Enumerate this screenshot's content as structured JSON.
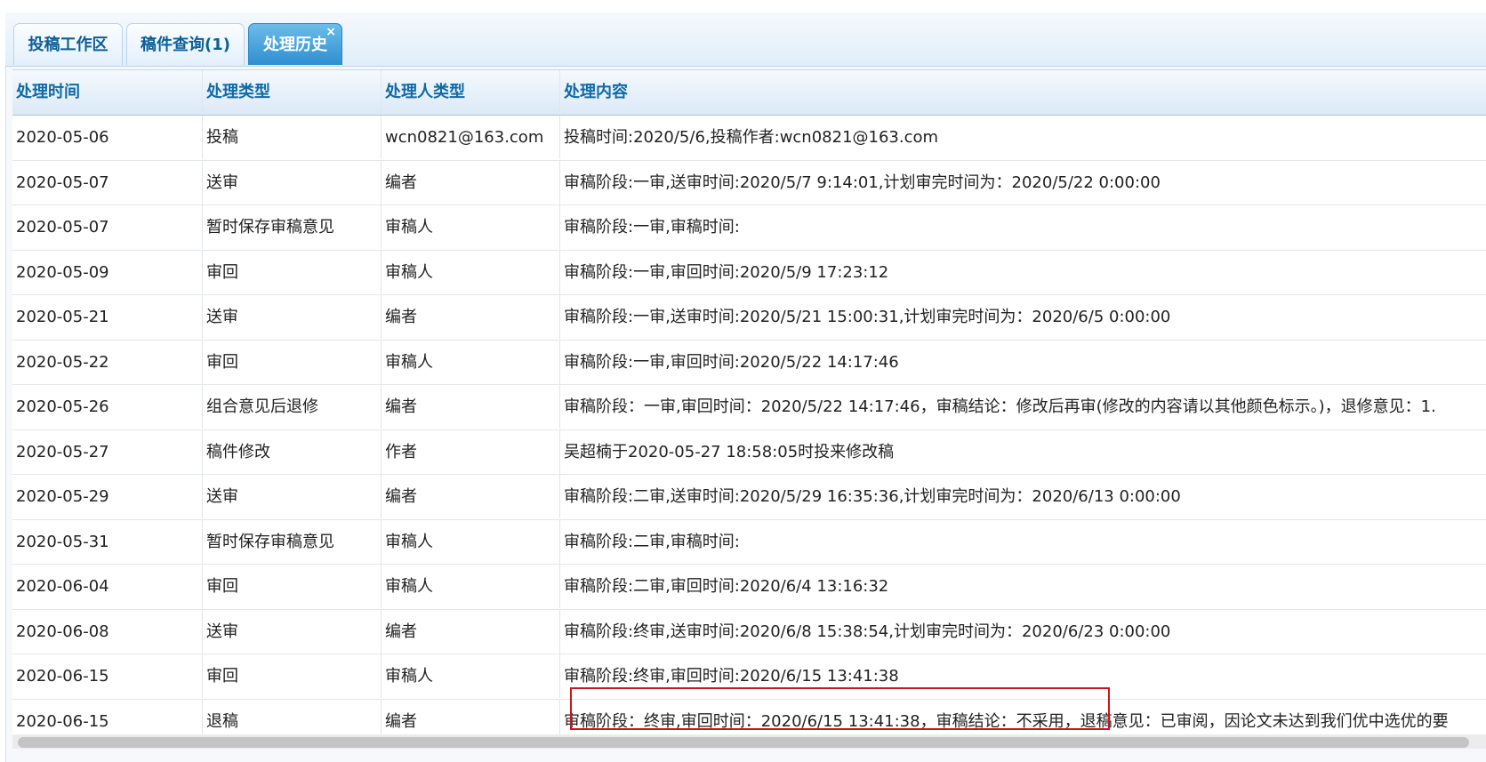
{
  "tabs": [
    {
      "label": "投稿工作区"
    },
    {
      "label": "稿件查询(1)"
    },
    {
      "label": "处理历史",
      "close": "×"
    }
  ],
  "table": {
    "headers": [
      "处理时间",
      "处理类型",
      "处理人类型",
      "处理内容"
    ],
    "rows": [
      [
        "2020-05-06",
        "投稿",
        "wcn0821@163.com",
        "投稿时间:2020/5/6,投稿作者:wcn0821@163.com"
      ],
      [
        "2020-05-07",
        "送审",
        "编者",
        "审稿阶段:一审,送审时间:2020/5/7 9:14:01,计划审完时间为：2020/5/22 0:00:00"
      ],
      [
        "2020-05-07",
        "暂时保存审稿意见",
        "审稿人",
        "审稿阶段:一审,审稿时间:"
      ],
      [
        "2020-05-09",
        "审回",
        "审稿人",
        "审稿阶段:一审,审回时间:2020/5/9 17:23:12"
      ],
      [
        "2020-05-21",
        "送审",
        "编者",
        "审稿阶段:一审,送审时间:2020/5/21 15:00:31,计划审完时间为：2020/6/5 0:00:00"
      ],
      [
        "2020-05-22",
        "审回",
        "审稿人",
        "审稿阶段:一审,审回时间:2020/5/22 14:17:46"
      ],
      [
        "2020-05-26",
        "组合意见后退修",
        "编者",
        "审稿阶段：一审,审回时间：2020/5/22 14:17:46，审稿结论：修改后再审(修改的内容请以其他颜色标示。)，退修意见：1."
      ],
      [
        "2020-05-27",
        "稿件修改",
        "作者",
        "吴超楠于2020-05-27 18:58:05时投来修改稿"
      ],
      [
        "2020-05-29",
        "送审",
        "编者",
        "审稿阶段:二审,送审时间:2020/5/29 16:35:36,计划审完时间为：2020/6/13 0:00:00"
      ],
      [
        "2020-05-31",
        "暂时保存审稿意见",
        "审稿人",
        "审稿阶段:二审,审稿时间:"
      ],
      [
        "2020-06-04",
        "审回",
        "审稿人",
        "审稿阶段:二审,审回时间:2020/6/4 13:16:32"
      ],
      [
        "2020-06-08",
        "送审",
        "编者",
        "审稿阶段:终审,送审时间:2020/6/8 15:38:54,计划审完时间为：2020/6/23 0:00:00"
      ],
      [
        "2020-06-15",
        "审回",
        "审稿人",
        "审稿阶段:终审,审回时间:2020/6/15 13:41:38"
      ],
      [
        "2020-06-15",
        "退稿",
        "编者",
        "审稿阶段：终审,审回时间：2020/6/15 13:41:38，审稿结论：不采用，退稿意见：已审阅，因论文未达到我们优中选优的要"
      ]
    ]
  },
  "colors": {
    "tab_active": "#2e8fd0",
    "header_text": "#0f6aa6",
    "highlight_box": "#c8161d"
  }
}
